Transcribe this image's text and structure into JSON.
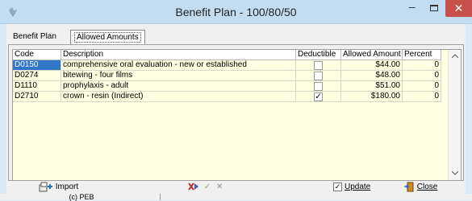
{
  "window": {
    "title": "Benefit Plan - 100/80/50",
    "min_glyph": "–",
    "close_glyph": "✕"
  },
  "tabs": [
    {
      "label": "Benefit Plan"
    },
    {
      "label": "Allowed Amounts"
    }
  ],
  "grid": {
    "columns": [
      "Code",
      "Description",
      "Deductible",
      "Allowed Amount",
      "Percent"
    ],
    "rows": [
      {
        "code": "D0150",
        "description": "comprehensive oral evaluation - new or established",
        "deductible": false,
        "allowed": "$44.00",
        "percent": "0",
        "selected": true
      },
      {
        "code": "D0274",
        "description": "bitewing - four films",
        "deductible": false,
        "allowed": "$48.00",
        "percent": "0"
      },
      {
        "code": "D1110",
        "description": "prophylaxis - adult",
        "deductible": false,
        "allowed": "$51.00",
        "percent": "0"
      },
      {
        "code": "D2710",
        "description": "crown - resin (Indirect)",
        "deductible": true,
        "allowed": "$180.00",
        "percent": "0"
      }
    ],
    "scroll_up": "^",
    "scroll_down": "v"
  },
  "toolbar": {
    "import_label": "Import",
    "update_label": "Update",
    "update_checked": true,
    "close_label": "Close",
    "check_glyph": "✓",
    "x_glyph": "✕"
  },
  "status": {
    "copyright": "(c) PEB"
  },
  "colors": {
    "grid_bg": "#ffffe1",
    "selection": "#3276c8",
    "close_red": "#c7504b"
  }
}
